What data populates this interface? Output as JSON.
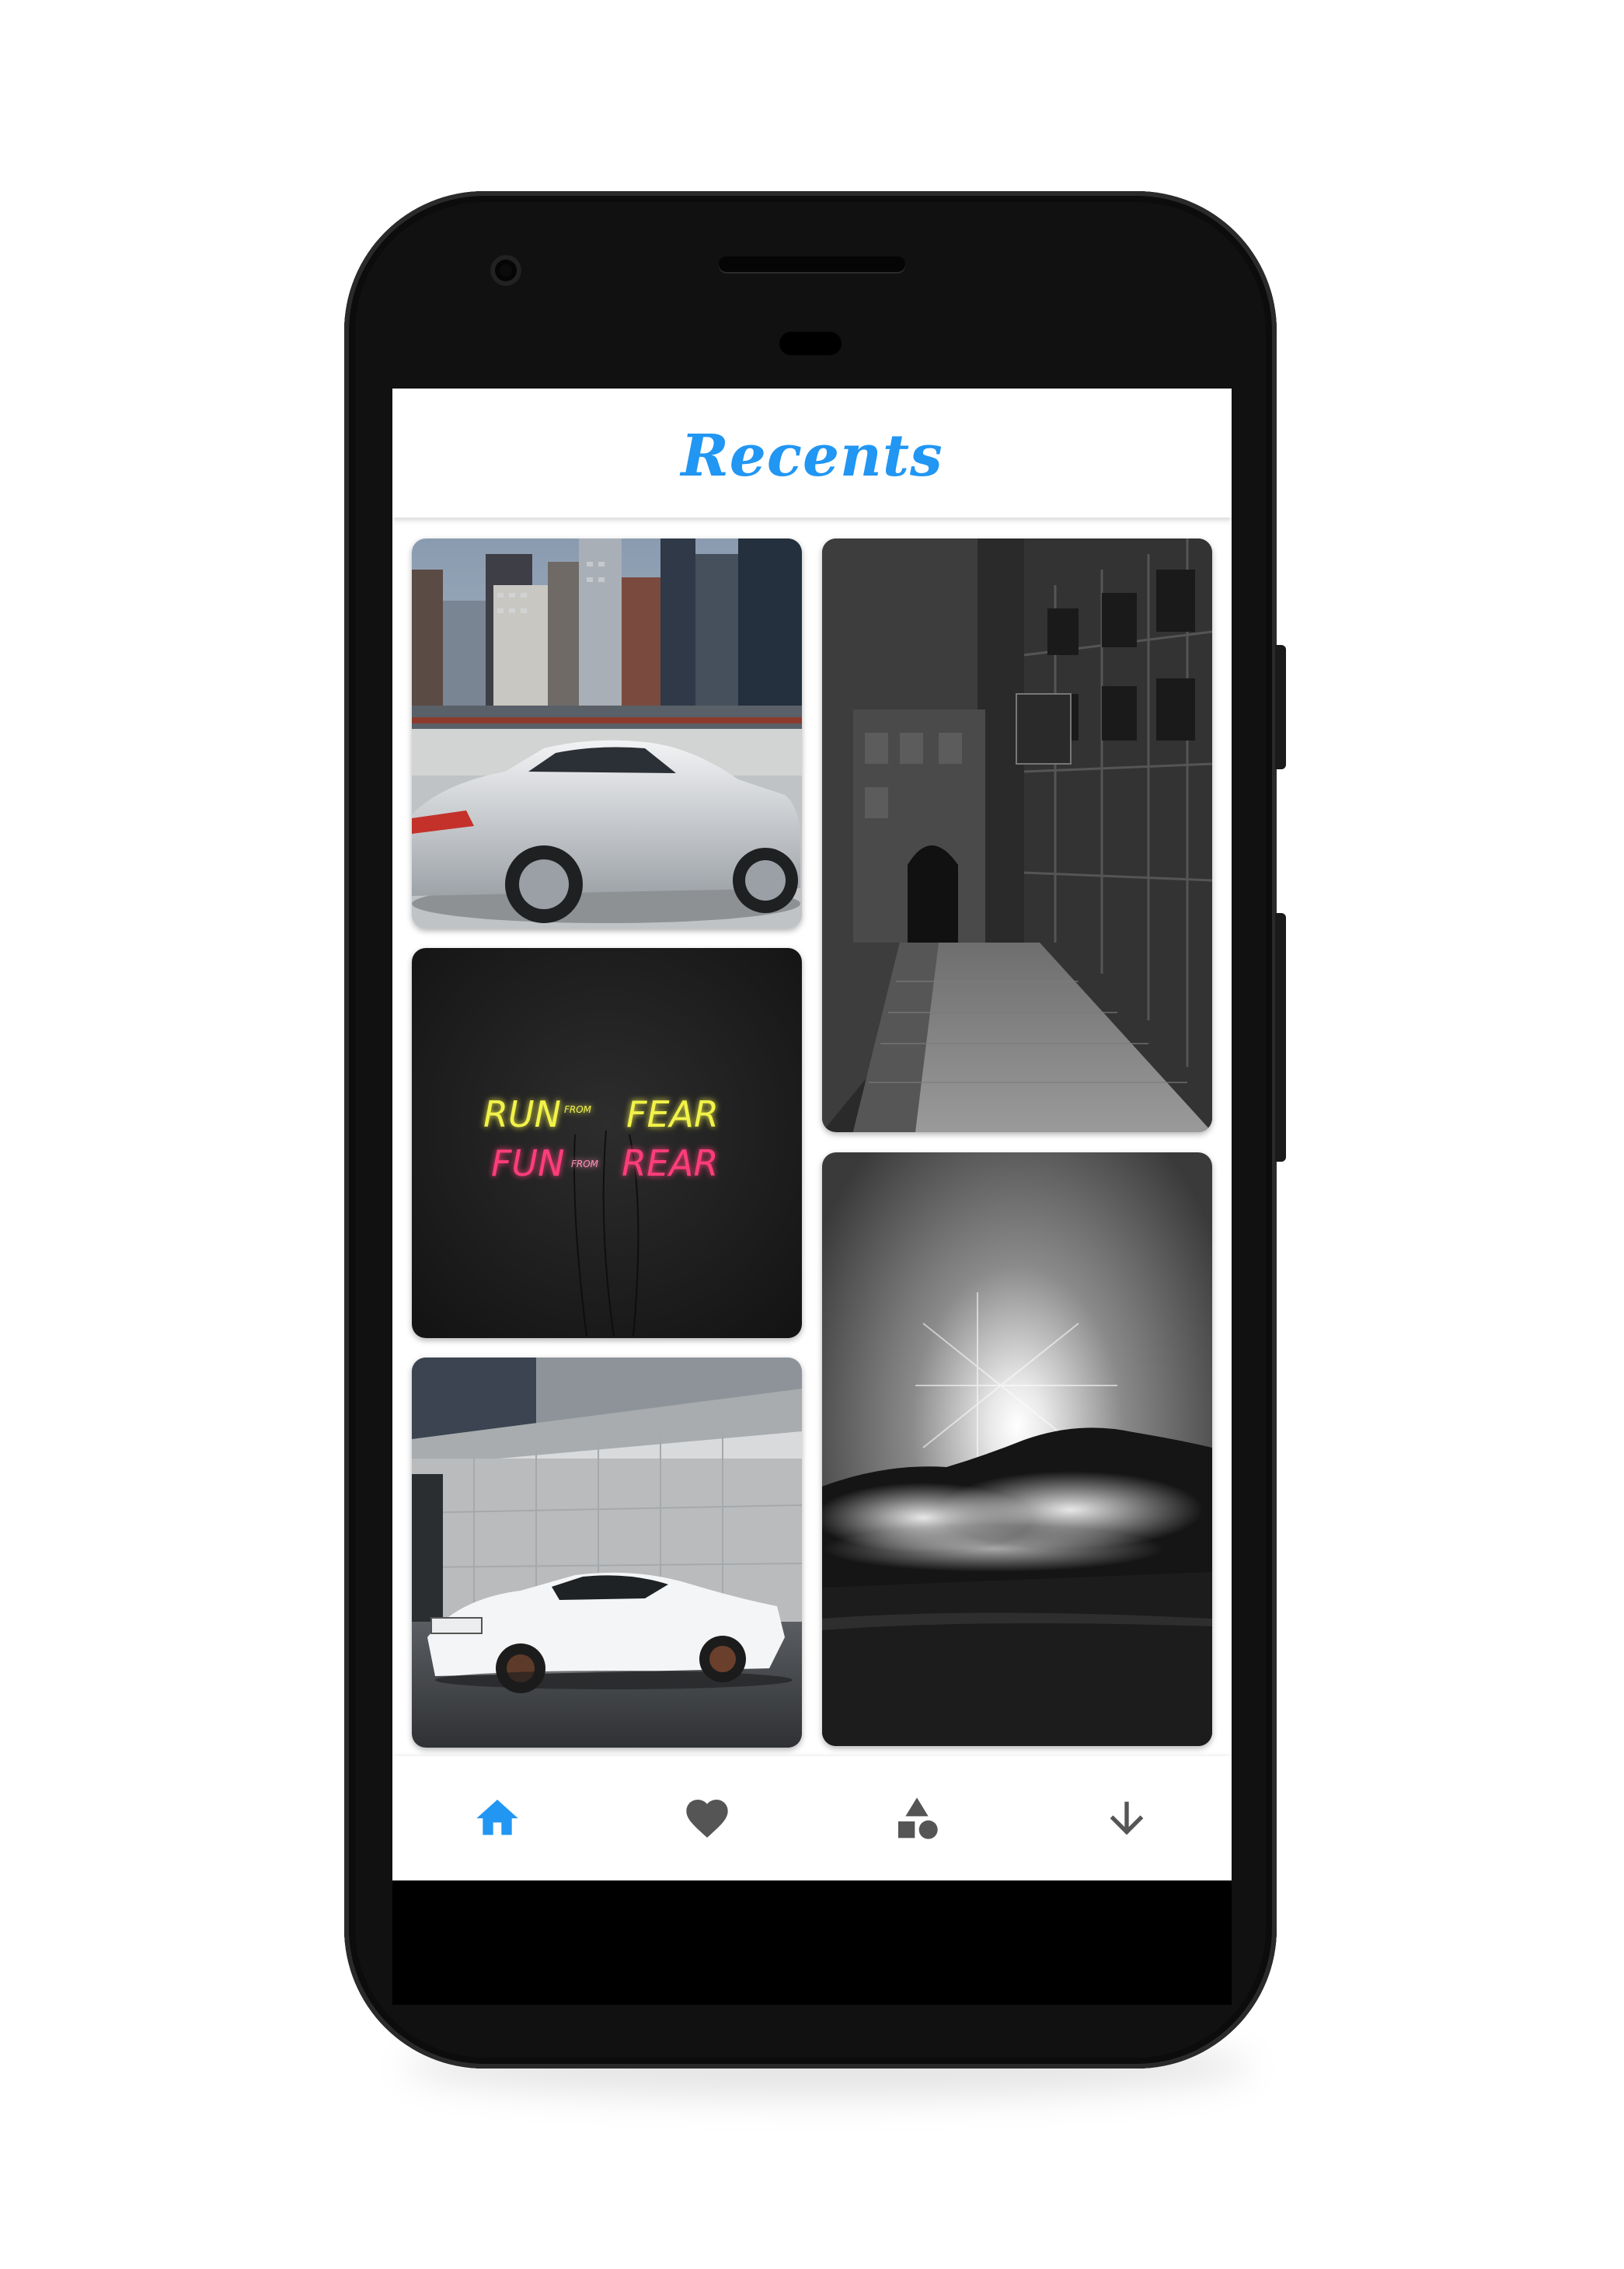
{
  "app": {
    "title": "Recents",
    "accent_color": "#2196F3",
    "inactive_icon_color": "#555555"
  },
  "wallpapers": [
    {
      "name": "silver-hatchback-city"
    },
    {
      "name": "neon-sign-wall"
    },
    {
      "name": "white-sports-car"
    },
    {
      "name": "cobblestone-street-bw"
    },
    {
      "name": "sunburst-mountain-bw"
    }
  ],
  "neon_sign": {
    "line1_left": "RUN",
    "line1_small": "FROM",
    "line1_right": "FEAR",
    "line2_left": "FUN",
    "line2_small": "FROM",
    "line2_right": "REAR"
  },
  "bottom_nav": {
    "items": [
      {
        "icon": "home-icon",
        "active": true
      },
      {
        "icon": "heart-icon",
        "active": false
      },
      {
        "icon": "categories-icon",
        "active": false
      },
      {
        "icon": "download-icon",
        "active": false
      }
    ]
  }
}
